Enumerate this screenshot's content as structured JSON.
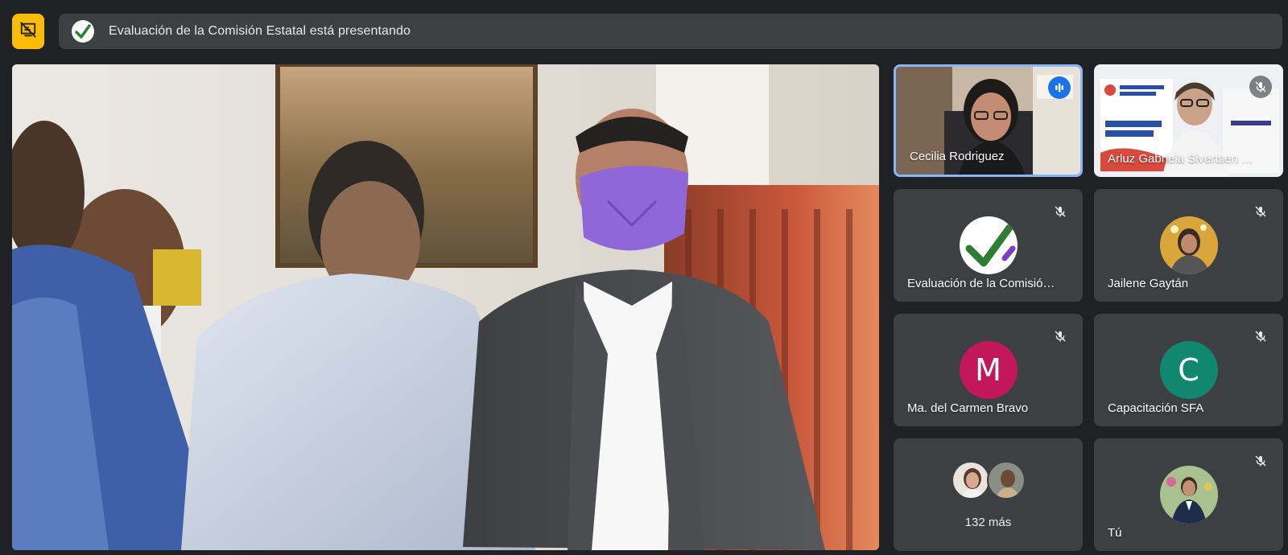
{
  "banner": {
    "text": "Evaluación de la Comisión Estatal está presentando"
  },
  "icons": {
    "present_toggle": "presentation-off-icon",
    "presenter_logo": "checkmark-logo-icon",
    "muted": "mic-off-icon",
    "speaking": "speaking-bars-icon"
  },
  "colors": {
    "accent_yellow": "#fbbc04",
    "active_border": "#8ab4f8",
    "speaking_blue": "#1a73e8",
    "avatar_m": "#c2185b",
    "avatar_c": "#12876f"
  },
  "participants": [
    {
      "name": "Cecilia Rodriguez",
      "speaking": true,
      "muted": false,
      "video": true
    },
    {
      "name": "Arluz Gabriela Sivertsen …",
      "speaking": false,
      "muted": true,
      "video": true
    },
    {
      "name": "Evaluación de la Comisió…",
      "muted": true,
      "avatar": "checkmark-logo"
    },
    {
      "name": "Jailene Gaytán",
      "muted": true,
      "avatar": "photo"
    },
    {
      "name": "Ma. del Carmen Bravo",
      "muted": true,
      "avatar_letter": "M"
    },
    {
      "name": "Capacitación SFA",
      "muted": true,
      "avatar_letter": "C"
    },
    {
      "name": "Tú",
      "muted": true,
      "avatar": "photo"
    }
  ],
  "more": {
    "label": "132 más"
  }
}
